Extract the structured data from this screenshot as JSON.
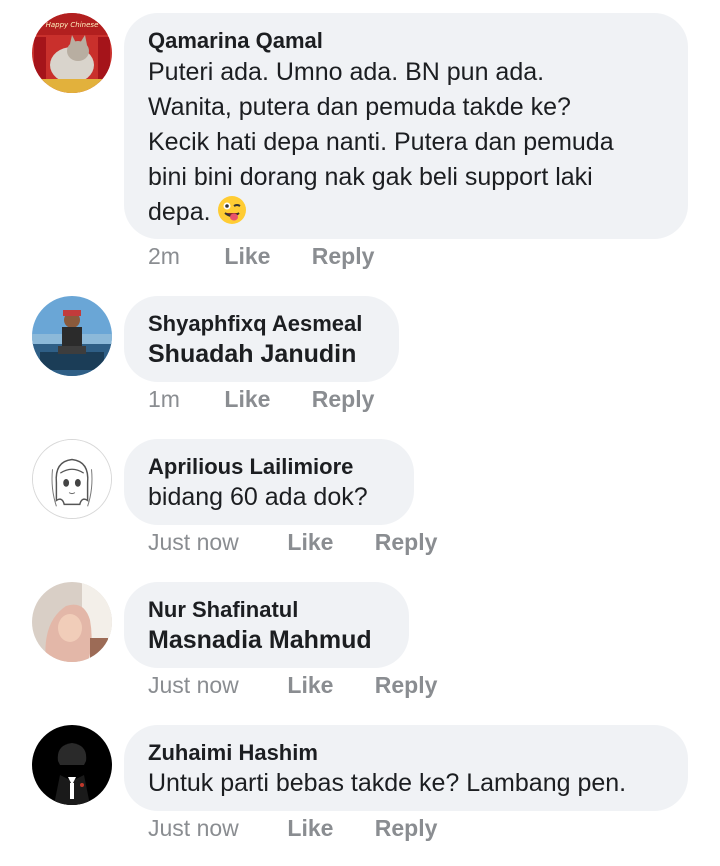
{
  "comments": [
    {
      "author": "Qamarina Qamal",
      "text_lines": [
        "Puteri ada. Umno ada. BN pun ada.",
        "Wanita, putera dan pemuda takde ke?",
        "Kecik hati depa nanti. Putera dan pemuda",
        "bini bini dorang nak gak beli support laki",
        "depa."
      ],
      "avatar_text": "Happy Chinese",
      "emoji": "winking-face-with-tongue",
      "time": "2m",
      "like": "Like",
      "reply": "Reply"
    },
    {
      "author": "Shyaphfixq Aesmeal",
      "tagged": "Shuadah Janudin",
      "time": "1m",
      "like": "Like",
      "reply": "Reply"
    },
    {
      "author": "Aprilious Lailimiore",
      "text": "bidang 60 ada dok?",
      "time": "Just now",
      "like": "Like",
      "reply": "Reply"
    },
    {
      "author": "Nur Shafinatul",
      "tagged": "Masnadia Mahmud",
      "time": "Just now",
      "like": "Like",
      "reply": "Reply"
    },
    {
      "author": "Zuhaimi Hashim",
      "text": "Untuk parti bebas takde ke? Lambang pen.",
      "time": "Just now",
      "like": "Like",
      "reply": "Reply"
    }
  ],
  "colors": {
    "bubble": "#f0f2f5",
    "text": "#1c1e21",
    "meta": "#8a8d91"
  }
}
